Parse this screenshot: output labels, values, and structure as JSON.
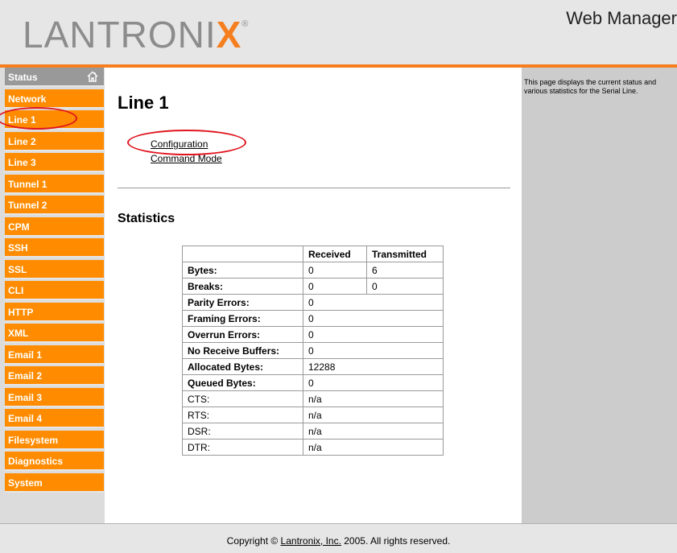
{
  "header": {
    "logo_text": "LANTRONIX",
    "title": "Web Manager"
  },
  "sidebar": {
    "items": [
      {
        "label": "Status",
        "icon": "home-icon"
      },
      {
        "label": "Network"
      },
      {
        "label": "Line 1"
      },
      {
        "label": "Line 2"
      },
      {
        "label": "Line 3"
      },
      {
        "label": "Tunnel 1"
      },
      {
        "label": "Tunnel 2"
      },
      {
        "label": "CPM"
      },
      {
        "label": "SSH"
      },
      {
        "label": "SSL"
      },
      {
        "label": "CLI"
      },
      {
        "label": "HTTP"
      },
      {
        "label": "XML"
      },
      {
        "label": "Email 1"
      },
      {
        "label": "Email 2"
      },
      {
        "label": "Email 3"
      },
      {
        "label": "Email 4"
      },
      {
        "label": "Filesystem"
      },
      {
        "label": "Diagnostics"
      },
      {
        "label": "System"
      }
    ]
  },
  "main": {
    "title": "Line 1",
    "links": [
      "Configuration",
      "Command Mode"
    ],
    "stats_title": "Statistics",
    "table": {
      "headers": [
        "",
        "Received",
        "Transmitted"
      ],
      "rows": [
        [
          "Bytes:",
          "0",
          "6"
        ],
        [
          "Breaks:",
          "0",
          "0"
        ],
        [
          "Parity Errors:",
          "0"
        ],
        [
          "Framing Errors:",
          "0"
        ],
        [
          "Overrun Errors:",
          "0"
        ],
        [
          "No Receive Buffers:",
          "0"
        ],
        [
          "Allocated Bytes:",
          "12288"
        ],
        [
          "Queued Bytes:",
          "0"
        ],
        [
          "CTS:",
          "n/a"
        ],
        [
          "RTS:",
          "n/a"
        ],
        [
          "DSR:",
          "n/a"
        ],
        [
          "DTR:",
          "n/a"
        ]
      ]
    }
  },
  "info": {
    "text": "This page displays the current status and various statistics for the Serial Line."
  },
  "footer": {
    "prefix": "Copyright © ",
    "link": "Lantronix, Inc.",
    "suffix": " 2005. All rights reserved."
  },
  "colors": {
    "accent": "#f57f1f",
    "nav": "#ff8c00",
    "annotation": "#e0141e"
  }
}
